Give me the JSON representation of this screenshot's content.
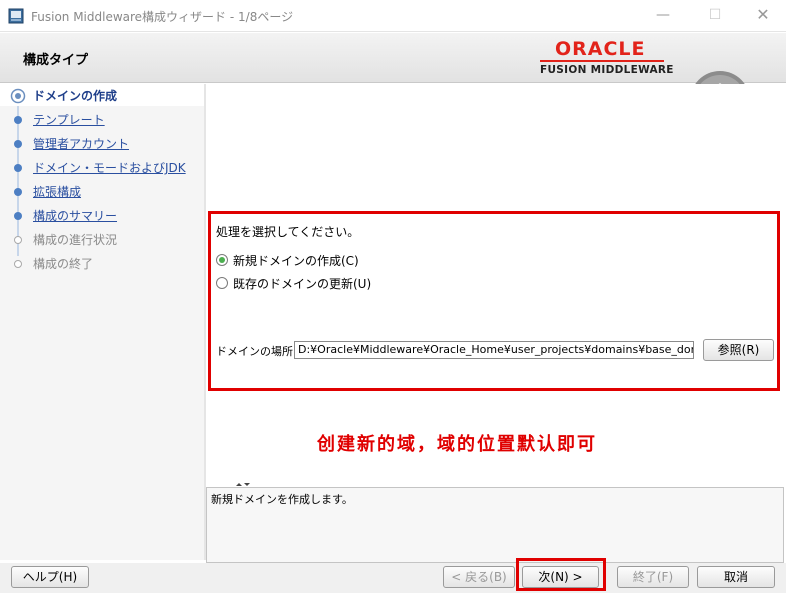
{
  "window": {
    "title": "Fusion Middleware構成ウィザード - 1/8ページ",
    "controls": {
      "minimize": "—",
      "maximize": "☐",
      "close": "✕"
    }
  },
  "header": {
    "page_title": "構成タイプ",
    "logo_text": "ORACLE",
    "logo_subtitle": "FUSION MIDDLEWARE",
    "brand_color": "#e2231a"
  },
  "nav": {
    "items": [
      {
        "label": "ドメインの作成",
        "state": "active"
      },
      {
        "label": "テンプレート",
        "state": "link"
      },
      {
        "label": "管理者アカウント",
        "state": "link"
      },
      {
        "label": "ドメイン・モードおよびJDK",
        "state": "link"
      },
      {
        "label": "拡張構成",
        "state": "link"
      },
      {
        "label": "構成のサマリー",
        "state": "link"
      },
      {
        "label": "構成の進行状況",
        "state": "disabled"
      },
      {
        "label": "構成の終了",
        "state": "disabled"
      }
    ]
  },
  "main": {
    "prompt": "処理を選択してください。",
    "options": [
      {
        "label": "新規ドメインの作成(C)",
        "selected": true
      },
      {
        "label": "既存のドメインの更新(U)",
        "selected": false
      }
    ],
    "location_label": "ドメインの場所:",
    "location_value": "D:¥Oracle¥Middleware¥Oracle_Home¥user_projects¥domains¥base_domain",
    "browse_label": "参照(R)",
    "annotation": "创建新的域，域的位置默认即可",
    "annotation_color": "#e00000"
  },
  "description": {
    "text": "新規ドメインを作成します。"
  },
  "footer": {
    "help": "ヘルプ(H)",
    "back": "< 戻る(B)",
    "next": "次(N) >",
    "finish": "終了(F)",
    "cancel": "取消"
  }
}
